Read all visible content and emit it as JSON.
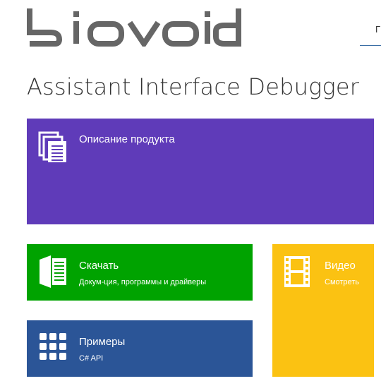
{
  "header": {
    "logo_text": "biovoid",
    "nav_partial": "Г"
  },
  "page": {
    "title": "Assistant Interface Debugger"
  },
  "tiles": {
    "description": {
      "title": "Описание продукта",
      "icon": "document-icon",
      "color": "#5f3bb9"
    },
    "download": {
      "title": "Скачать",
      "subtitle": "Докум-ция, программы и драйверы",
      "icon": "file-cabinet-icon",
      "color": "#00a300"
    },
    "examples": {
      "title": "Примеры",
      "subtitle": "C# API",
      "icon": "grid-icon",
      "color": "#2b5597"
    },
    "video": {
      "title": "Видео",
      "subtitle": "Смотреть",
      "icon": "film-icon",
      "color": "#fbc212"
    }
  }
}
